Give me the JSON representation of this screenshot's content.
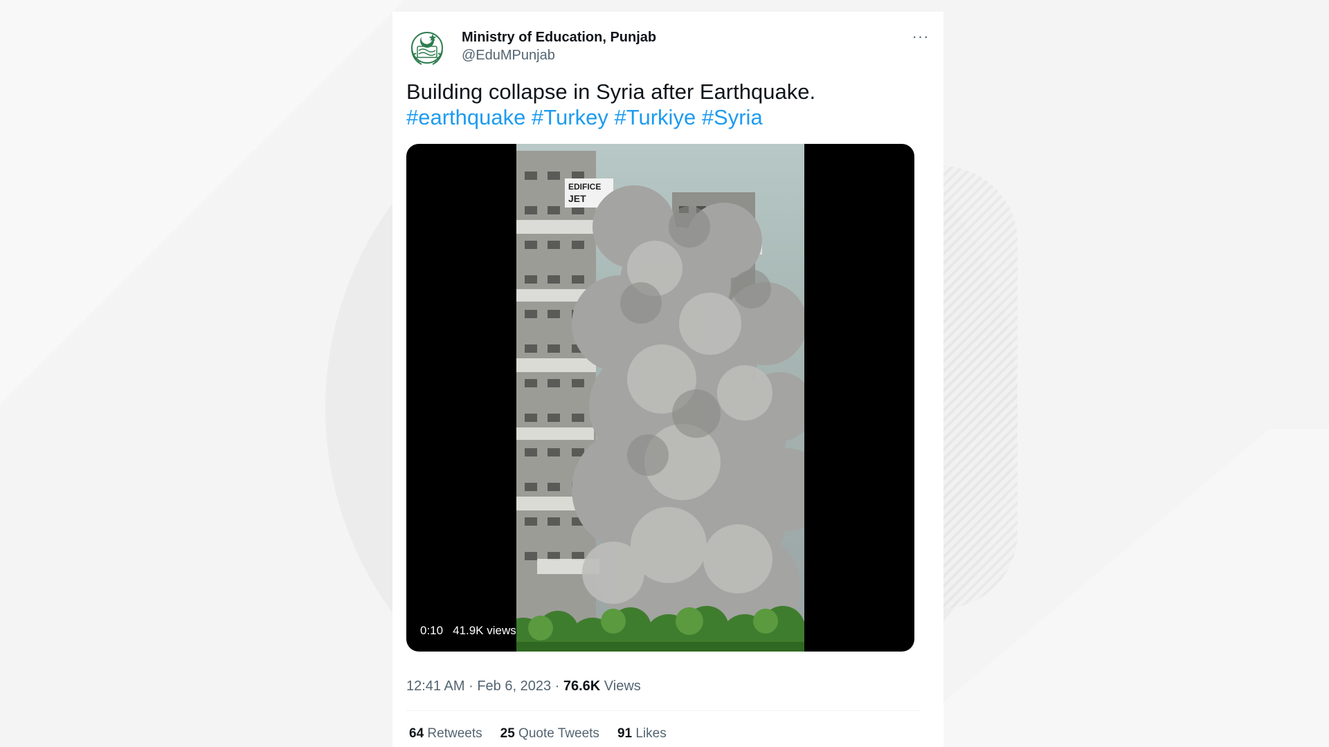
{
  "tweet": {
    "author_name": "Ministry of Education, Punjab",
    "author_handle": "@EduMPunjab",
    "more_label": "···",
    "text": "Building collapse in Syria after Earthquake.",
    "hashtags": [
      "#earthquake",
      "#Turkey",
      "#Turkiye",
      "#Syria"
    ],
    "media": {
      "duration": "0:10",
      "views": "41.9K views",
      "banner_text": [
        "EDIFICE",
        "JET"
      ]
    },
    "time": "12:41 AM",
    "separator": "·",
    "date": "Feb 6, 2023",
    "views_count": "76.6K",
    "views_label": "Views"
  },
  "stats": {
    "retweets_count": "64",
    "retweets_label": "Retweets",
    "quotes_count": "25",
    "quotes_label": "Quote Tweets",
    "likes_count": "91",
    "likes_label": "Likes"
  },
  "colors": {
    "link": "#1d9bf0",
    "text": "#0f1419",
    "secondary": "#536471",
    "logo_green": "#2e7d4f"
  },
  "icons": {
    "avatar": "punjab-emblem-icon",
    "more": "more-dots-icon"
  }
}
